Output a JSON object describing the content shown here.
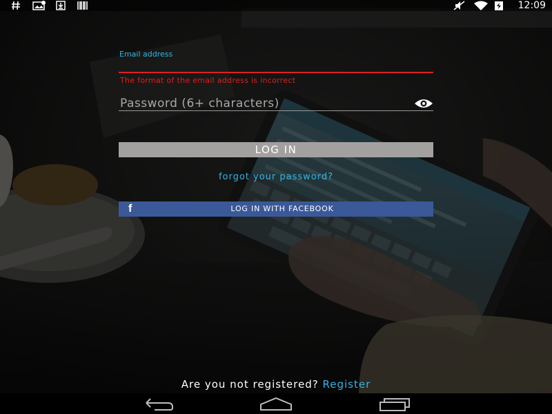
{
  "status_bar": {
    "time": "12:09",
    "left_icons": [
      "hash-icon",
      "image-notification-icon",
      "download-icon",
      "barcode-icon"
    ],
    "right_icons": [
      "mute-icon",
      "wifi-icon",
      "battery-charging-icon"
    ]
  },
  "login_form": {
    "email_label": "Email address",
    "email_value": "",
    "email_error": "The format of the email address is incorrect",
    "password_placeholder": "Password (6+ characters)",
    "login_label": "LOG IN",
    "forgot_password": "forgot your password?",
    "facebook_label": "LOG IN WITH FACEBOOK"
  },
  "register": {
    "prompt": "Are you not registered?",
    "link": "Register"
  },
  "nav_bar": {
    "buttons": [
      "back-icon",
      "home-icon",
      "recents-icon"
    ]
  },
  "colors": {
    "accent": "#33b5e5",
    "error": "#e02020",
    "login_button": "#a3a19f",
    "facebook": "#3b5998"
  }
}
